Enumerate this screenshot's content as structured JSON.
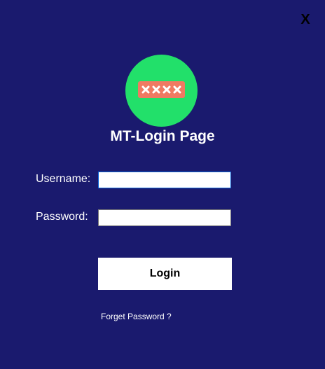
{
  "window": {
    "close_label": "X",
    "background": "#1a1a6e"
  },
  "logo": {
    "icon": "password-icon",
    "circle_color": "#22e06a",
    "box_color": "#f07a62",
    "mask_chars": "××××"
  },
  "header": {
    "title": "MT-Login Page"
  },
  "form": {
    "username_label": "Username:",
    "username_value": "",
    "password_label": "Password:",
    "password_value": "",
    "login_label": "Login",
    "forgot_label": "Forget Password ?"
  }
}
